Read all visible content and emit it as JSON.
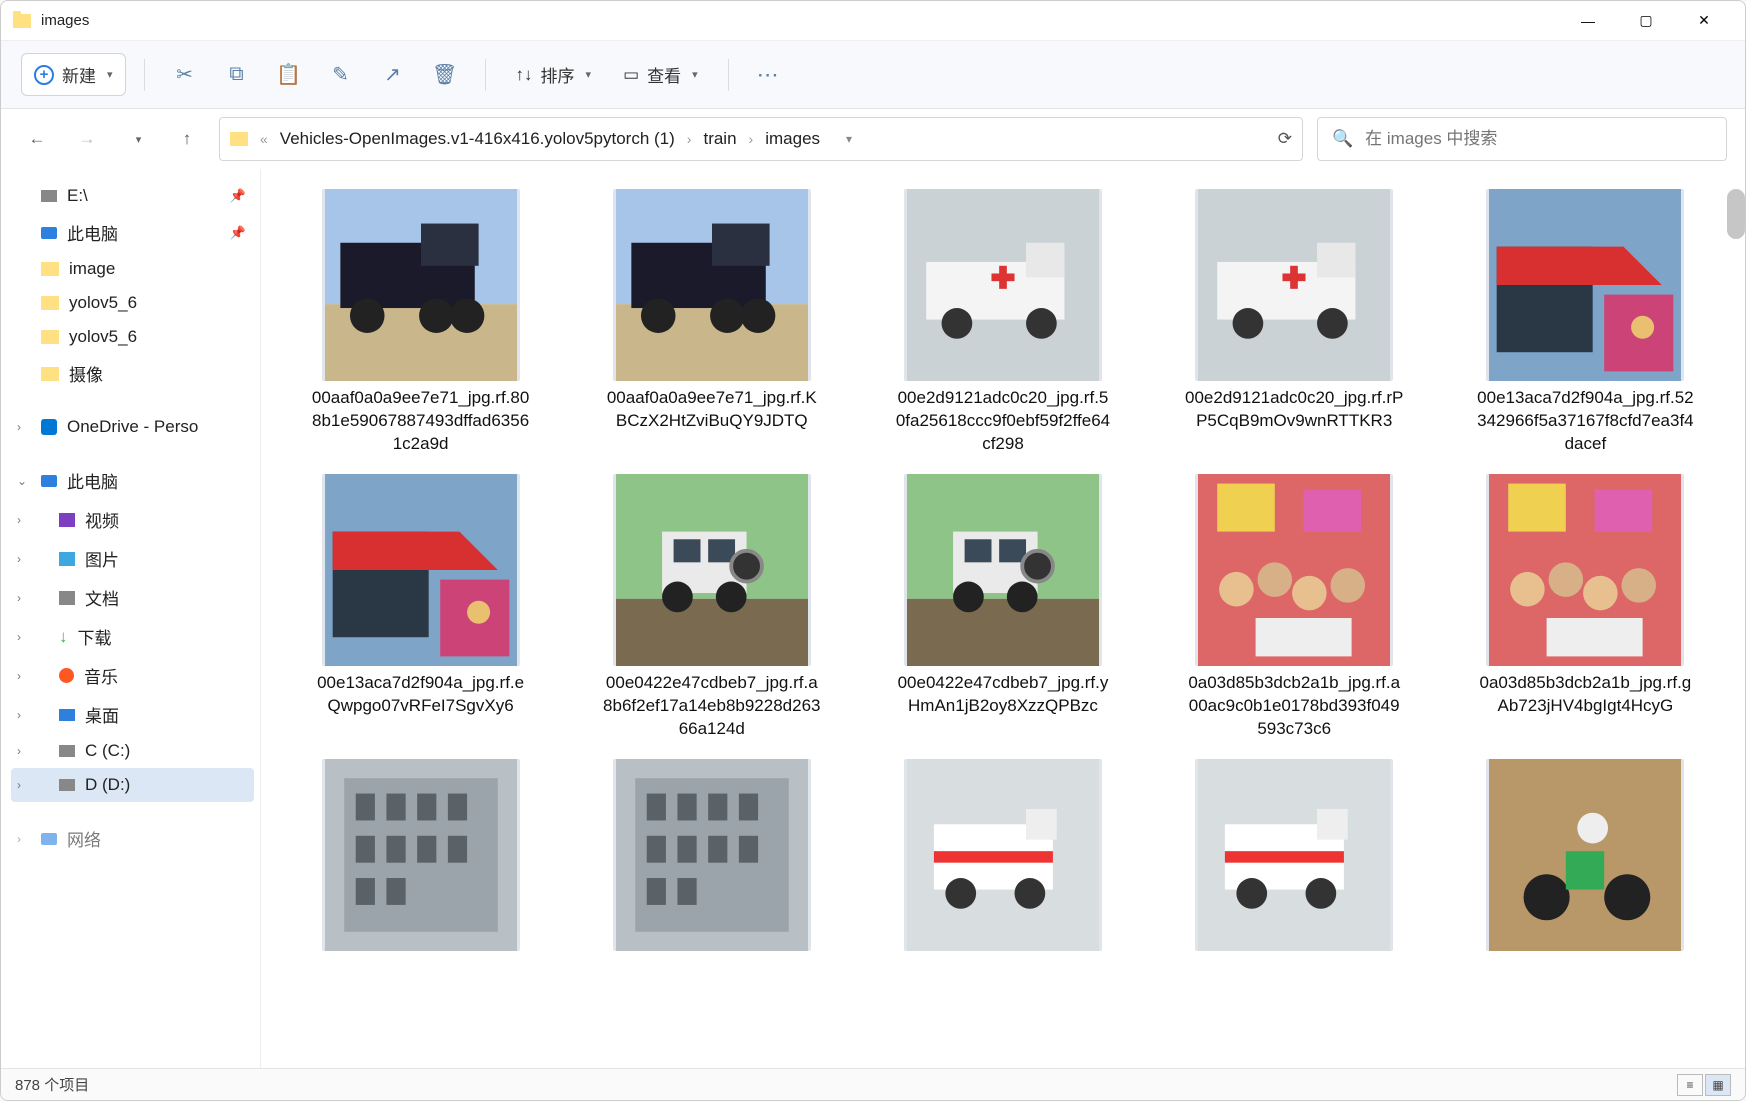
{
  "window": {
    "title": "images"
  },
  "toolbar": {
    "new_label": "新建",
    "sort_label": "排序",
    "view_label": "查看"
  },
  "breadcrumb": {
    "root": "«",
    "parts": [
      "Vehicles-OpenImages.v1-416x416.yolov5pytorch (1)",
      "train",
      "images"
    ]
  },
  "search": {
    "placeholder": "在 images 中搜索"
  },
  "sidebar": {
    "quick": [
      {
        "label": "E:\\",
        "icon": "drive",
        "pinned": true
      },
      {
        "label": "此电脑",
        "icon": "pc",
        "pinned": true
      },
      {
        "label": "image",
        "icon": "folder"
      },
      {
        "label": "yolov5_6",
        "icon": "folder"
      },
      {
        "label": "yolov5_6",
        "icon": "folder"
      },
      {
        "label": "摄像",
        "icon": "folder"
      }
    ],
    "onedrive": "OneDrive - Perso",
    "thispc": {
      "label": "此电脑",
      "children": [
        {
          "label": "视频",
          "icon": "video"
        },
        {
          "label": "图片",
          "icon": "picture"
        },
        {
          "label": "文档",
          "icon": "doc"
        },
        {
          "label": "下载",
          "icon": "download"
        },
        {
          "label": "音乐",
          "icon": "music"
        },
        {
          "label": "桌面",
          "icon": "desktop"
        },
        {
          "label": "C (C:)",
          "icon": "drive"
        },
        {
          "label": "D (D:)",
          "icon": "drive",
          "selected": true
        }
      ]
    },
    "network_trunc": "网络"
  },
  "files": [
    {
      "name": "00aaf0a0a9ee7e71_jpg.rf.808b1e59067887493dffad63561c2a9d",
      "thumb": "truck"
    },
    {
      "name": "00aaf0a0a9ee7e71_jpg.rf.KBCzX2HtZviBuQY9JDTQ",
      "thumb": "truck"
    },
    {
      "name": "00e2d9121adc0c20_jpg.rf.50fa25618ccc9f0ebf59f2ffe64cf298",
      "thumb": "ambulance"
    },
    {
      "name": "00e2d9121adc0c20_jpg.rf.rPP5CqB9mOv9wnRTTKR3",
      "thumb": "ambulance"
    },
    {
      "name": "00e13aca7d2f904a_jpg.rf.52342966f5a37167f8cfd7ea3f4dacef",
      "thumb": "awning"
    },
    {
      "name": "00e13aca7d2f904a_jpg.rf.eQwpgo07vRFeI7SgvXy6",
      "thumb": "awning"
    },
    {
      "name": "00e0422e47cdbeb7_jpg.rf.a8b6f2ef17a14eb8b9228d26366a124d",
      "thumb": "suv"
    },
    {
      "name": "00e0422e47cdbeb7_jpg.rf.yHmAn1jB2oy8XzzQPBzc",
      "thumb": "suv"
    },
    {
      "name": "0a03d85b3dcb2a1b_jpg.rf.a00ac9c0b1e0178bd393f049593c73c6",
      "thumb": "crowd"
    },
    {
      "name": "0a03d85b3dcb2a1b_jpg.rf.gAb723jHV4bgIgt4HcyG",
      "thumb": "crowd"
    },
    {
      "name": "",
      "thumb": "building"
    },
    {
      "name": "",
      "thumb": "building"
    },
    {
      "name": "",
      "thumb": "ambulance2"
    },
    {
      "name": "",
      "thumb": "ambulance2"
    },
    {
      "name": "",
      "thumb": "moto"
    }
  ],
  "status": {
    "count": "878 个项目"
  }
}
